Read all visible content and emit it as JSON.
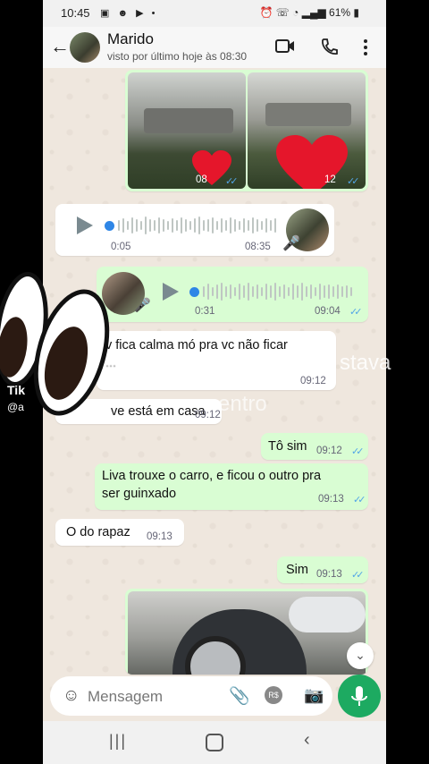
{
  "status_bar": {
    "time": "10:45",
    "battery": "61%"
  },
  "header": {
    "contact_name": "Marido",
    "last_seen": "visto por último hoje às 08:30"
  },
  "messages": {
    "photos_time_1": "08",
    "photos_time_2": "12",
    "audio_in": {
      "duration": "0:05",
      "time": "08:35"
    },
    "audio_out": {
      "duration": "0:31",
      "time": "09:04"
    },
    "text_in_1": {
      "line1": "v fica calma mó pra vc não ficar",
      "line2": "...",
      "time": "09:12"
    },
    "text_in_2": {
      "text": "ve está em casa",
      "time": "09:12"
    },
    "text_out_1": {
      "text": "Tô sim",
      "time": "09:12"
    },
    "text_out_2": {
      "line1": "Liva trouxe o carro, e ficou o outro pra",
      "line2": "ser guinxado",
      "time": "09:13"
    },
    "text_in_3": {
      "text": "O do rapaz",
      "time": "09:13"
    },
    "text_out_3": {
      "text": "Sim",
      "time": "09:13"
    }
  },
  "composer": {
    "placeholder": "Mensagem"
  },
  "overlay": {
    "tiktok_label": "Tik",
    "tiktok_user": "@a",
    "caption_word_1": "stava",
    "caption_word_2": "entro"
  },
  "colors": {
    "outgoing": "#d9fdd3",
    "incoming": "#ffffff",
    "accent_green": "#1daa61",
    "ticks": "#53a6e7"
  }
}
